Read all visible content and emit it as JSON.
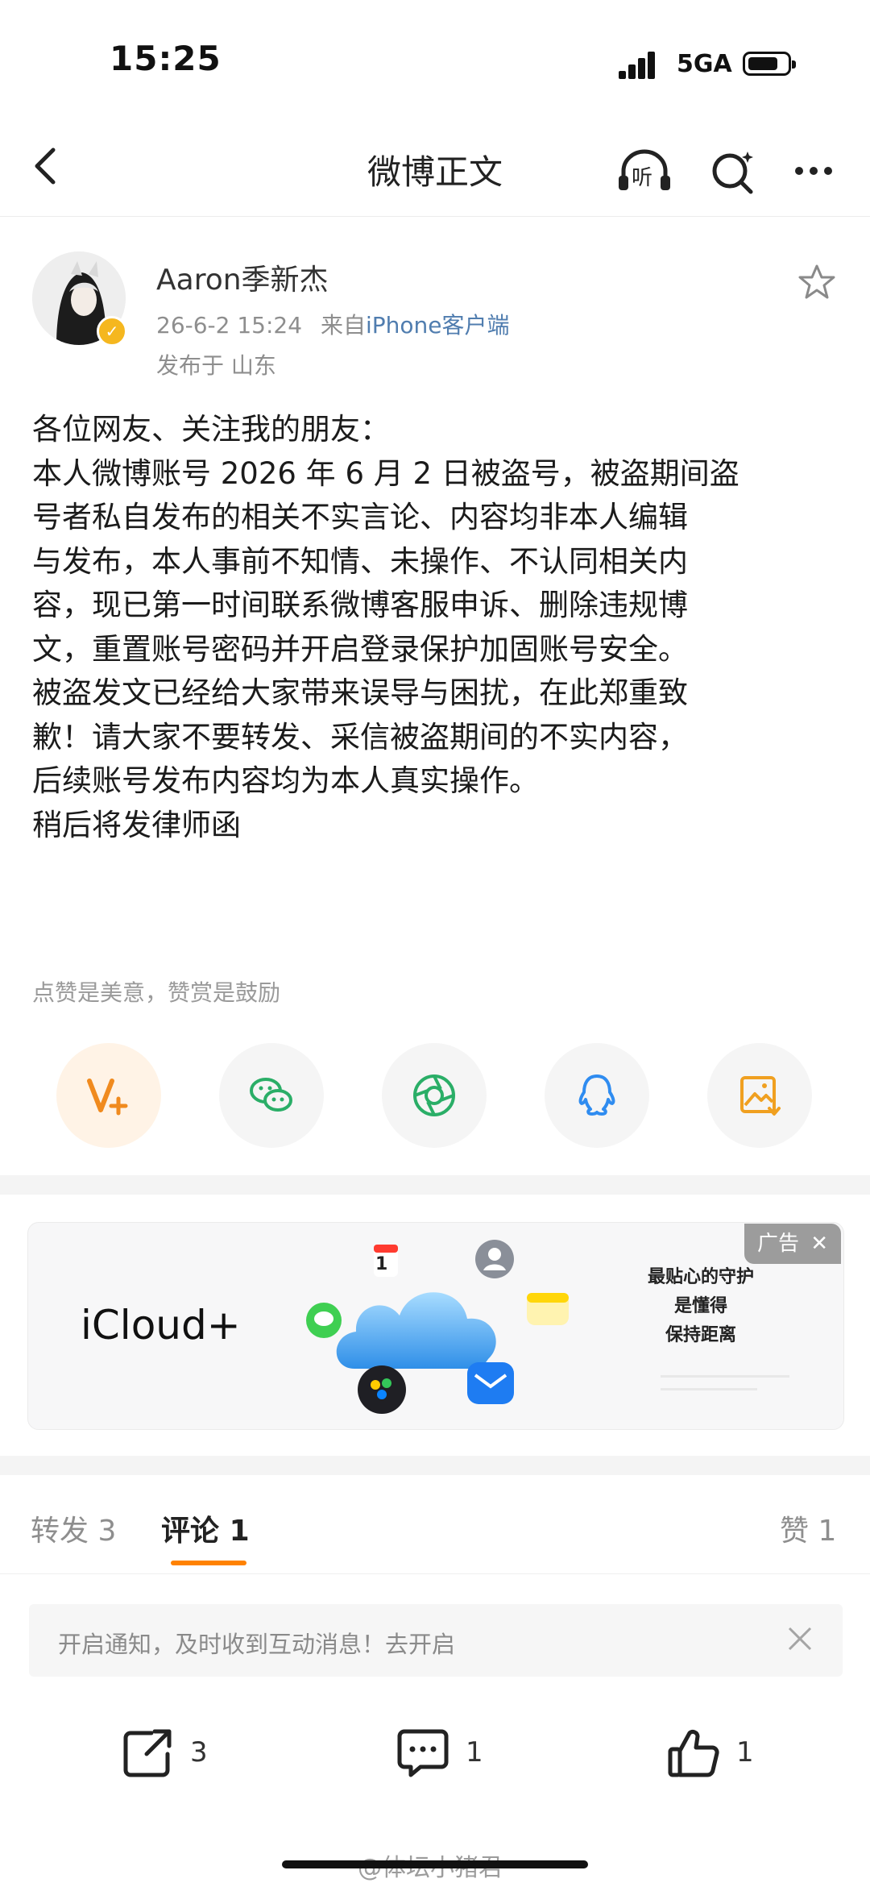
{
  "status_bar": {
    "time": "15:25",
    "network": "5GA"
  },
  "nav": {
    "title": "微博正文",
    "listen_icon_text": "听"
  },
  "post": {
    "author": "Aaron季新杰",
    "timestamp": "26-6-2 15:24",
    "source_prefix": "来自",
    "source": "iPhone客户端",
    "location": "发布于 山东",
    "lines": [
      "各位网友、关注我的朋友：",
      "本人微博账号 2026 年 6 月 2 日被盗号，被盗期间盗",
      "号者私自发布的相关不实言论、内容均非本人编辑",
      "与发布，本人事前不知情、未操作、不认同相关内",
      "容，现已第一时间联系微博客服申诉、删除违规博",
      "文，重置账号密码并开启登录保护加固账号安全。",
      "被盗发文已经给大家带来误导与困扰，在此郑重致",
      "歉！请大家不要转发、采信被盗期间的不实内容，",
      "后续账号发布内容均为本人真实操作。",
      "稍后将发律师函"
    ],
    "reward_tip": "点赞是美意，赞赏是鼓励"
  },
  "share": {
    "items": [
      {
        "icon": "reward-v-icon",
        "color": "#f08a1e"
      },
      {
        "icon": "wechat-icon",
        "color": "#2aae67"
      },
      {
        "icon": "moments-icon",
        "color": "#2aae67"
      },
      {
        "icon": "qq-icon",
        "color": "#2f8cf0"
      },
      {
        "icon": "save-image-icon",
        "color": "#f0a020"
      }
    ]
  },
  "ad": {
    "tag": "广告",
    "brand": "iCloud+",
    "badge_number": "1",
    "tagline": [
      "最贴心的守护",
      "是懂得",
      "保持距离"
    ]
  },
  "tabs": {
    "repost_label": "转发",
    "repost_count": "3",
    "comment_label": "评论",
    "comment_count": "1",
    "like_label": "赞",
    "like_count": "1"
  },
  "notice": {
    "text": "开启通知，及时收到互动消息！去开启"
  },
  "actions": {
    "repost_count": "3",
    "comment_count": "1",
    "like_count": "1"
  },
  "watermark": "@体坛小猪君",
  "colors": {
    "accent": "#ff8200",
    "link": "#507daf",
    "verified": "#f5b71f"
  }
}
